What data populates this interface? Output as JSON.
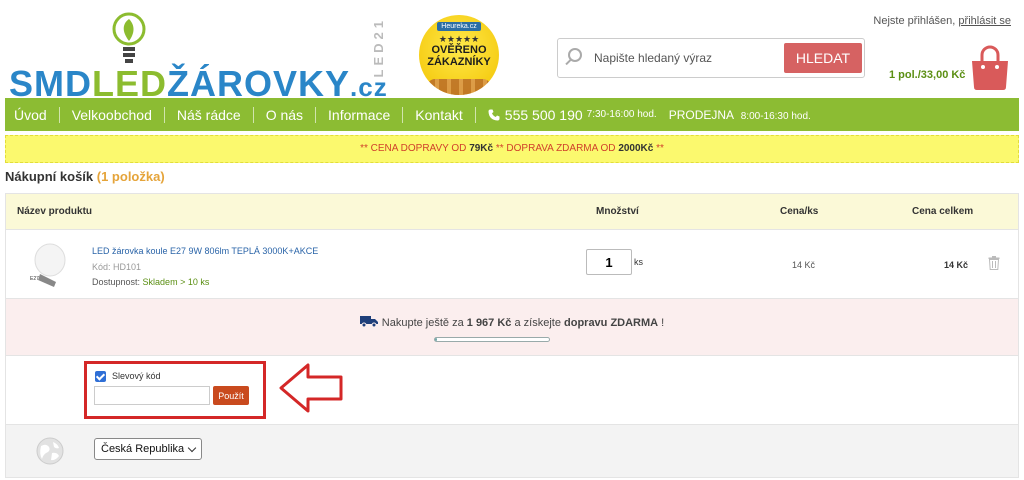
{
  "header": {
    "logo": {
      "part1": "SMD",
      "part2": "LED",
      "part3": "ŽÁROVKY",
      "part4": ".cz",
      "side": "LED21"
    },
    "badge": {
      "top": "Heureka.cz",
      "stars": "★★★★★",
      "line1": "OVĚŘENO",
      "line2": "ZÁKAZNÍKY"
    },
    "search": {
      "placeholder": "Napište hledaný výraz",
      "button": "HLEDAT"
    },
    "login": {
      "text": "Nejste přihlášen,",
      "link": "přihlásit se"
    },
    "cart_summary": "1 pol./33,00 Kč"
  },
  "nav": {
    "items": [
      "Úvod",
      "Velkoobchod",
      "Náš rádce",
      "O nás",
      "Informace",
      "Kontakt"
    ],
    "phone": "555 500 190",
    "phone_hours": "7:30-16:00 hod.",
    "shop": "PRODEJNA",
    "shop_hours": "8:00-16:30 hod."
  },
  "notice": {
    "p1": "** CENA DOPRAVY OD ",
    "v1": "79Kč",
    "p2": " ** DOPRAVA ZDARMA OD ",
    "v2": "2000Kč",
    "p3": " **"
  },
  "cart": {
    "title": "Nákupní košík",
    "count": "(1 položka)",
    "headers": {
      "name": "Název produktu",
      "qty": "Množství",
      "unit_price": "Cena/ks",
      "total": "Cena celkem"
    },
    "item": {
      "name": "LED žárovka koule E27 9W 806lm TEPLÁ 3000K+AKCE",
      "code": "Kód: HD101",
      "avail_label": "Dostupnost:",
      "avail_value": "Skladem > 10 ks",
      "qty": "1",
      "unit": "ks",
      "unit_price": "14 Kč",
      "total": "14 Kč"
    },
    "shipping": {
      "pre": "Nakupte ještě za ",
      "amount": "1 967 Kč",
      "mid": " a získejte ",
      "bold": "dopravu ZDARMA",
      "post": " !",
      "progress": 0.02
    },
    "coupon": {
      "label": "Slevový kód",
      "value": "",
      "button": "Použít",
      "checked": true
    },
    "country": {
      "selected": "Česká Republika"
    }
  },
  "colors": {
    "nav": "#8cbc33",
    "search_button": "#d66262",
    "coupon_button": "#c94a1e",
    "highlight": "#d42727",
    "notice_bg": "#fbf96e",
    "ship_bg": "#fbeeee"
  },
  "icons": [
    "bulb-icon",
    "search-icon",
    "shopping-bag-icon",
    "phone-icon",
    "trash-icon",
    "truck-icon",
    "globe-icon",
    "arrow-left-icon",
    "chevron-down-icon"
  ]
}
